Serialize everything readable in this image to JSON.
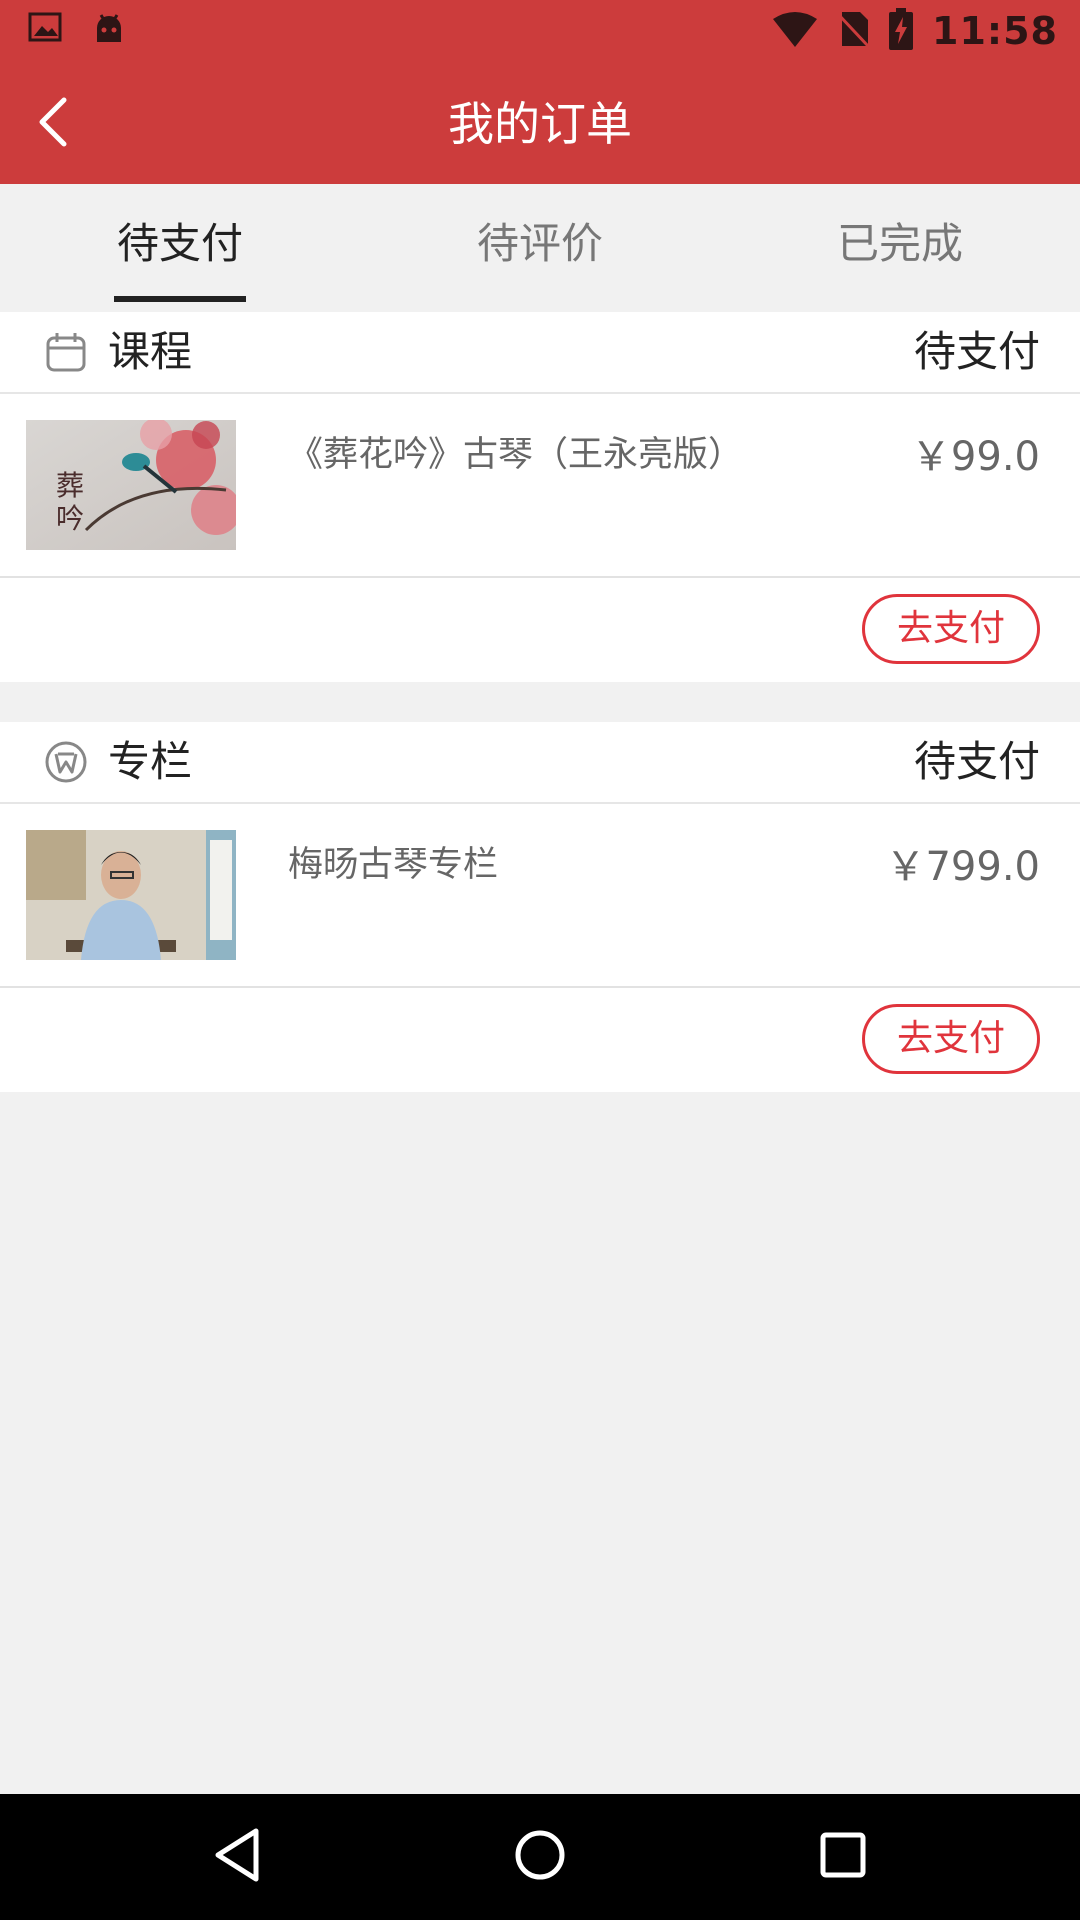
{
  "status_bar": {
    "time": "11:58",
    "icons": [
      "image-icon",
      "android-icon",
      "wifi-icon",
      "no-sim-icon",
      "battery-charging-icon"
    ]
  },
  "app_bar": {
    "back_icon": "chevron-left-icon",
    "title": "我的订单"
  },
  "tabs": [
    {
      "label": "待支付",
      "active": true
    },
    {
      "label": "待评价",
      "active": false
    },
    {
      "label": "已完成",
      "active": false
    }
  ],
  "orders": [
    {
      "type_icon": "calendar-icon",
      "type_label": "课程",
      "status": "待支付",
      "thumbnail": "flower-bird-painting",
      "title": "《葬花吟》古琴（王永亮版）",
      "price": "￥99.0",
      "action_label": "去支付"
    },
    {
      "type_icon": "column-w-icon",
      "type_label": "专栏",
      "status": "待支付",
      "thumbnail": "man-playing-guqin-photo",
      "title": "梅旸古琴专栏",
      "price": "￥799.0",
      "action_label": "去支付"
    }
  ],
  "nav_bar": {
    "icons": [
      "back-triangle-icon",
      "home-circle-icon",
      "recents-square-icon"
    ]
  },
  "colors": {
    "primary": "#cc3c3c",
    "accent": "#e0343c",
    "background": "#f1f1f1"
  }
}
